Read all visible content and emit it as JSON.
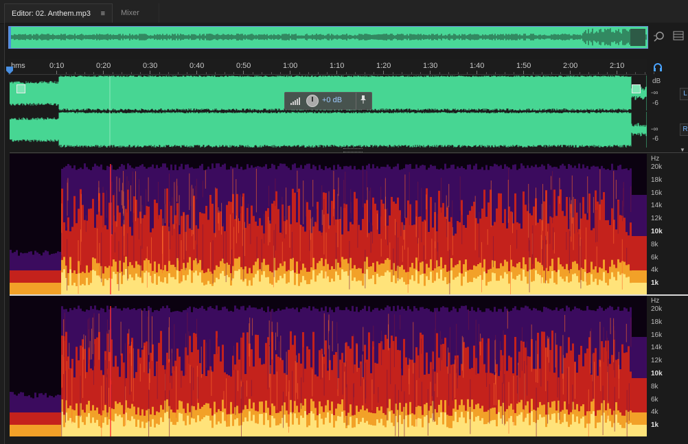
{
  "tabs": {
    "editor_label": "Editor: 02. Anthem.mp3",
    "editor_menu_icon": "≡",
    "mixer_label": "Mixer"
  },
  "toolbar": {
    "zoom_icon": "zoom-icon",
    "panel_menu_icon": "panel-menu-icon",
    "headphones_icon": "headphones-icon"
  },
  "ruler": {
    "unit_label": "hms",
    "ticks": [
      "0:10",
      "0:20",
      "0:30",
      "0:40",
      "0:50",
      "1:00",
      "1:10",
      "1:20",
      "1:30",
      "1:40",
      "1:50",
      "2:00",
      "2:10"
    ]
  },
  "waveform": {
    "db_label_top": "dB",
    "l_inf": "-∞",
    "l_minus6": "-6",
    "r_inf": "-∞",
    "r_minus6": "-6",
    "left_channel": "L",
    "right_channel": "R"
  },
  "gain_hud": {
    "value": "+0 dB",
    "pin_icon": "pin-icon"
  },
  "spectrogram": {
    "unit": "Hz",
    "labels": [
      "20k",
      "18k",
      "16k",
      "14k",
      "12k",
      "10k",
      "8k",
      "6k",
      "4k",
      "1k"
    ]
  },
  "colors": {
    "waveform": "#47d693",
    "accent": "#4a90e2",
    "spectral_low": "#ffe37a",
    "spectral_mid": "#e0301e",
    "spectral_high": "#3a0a5a"
  }
}
